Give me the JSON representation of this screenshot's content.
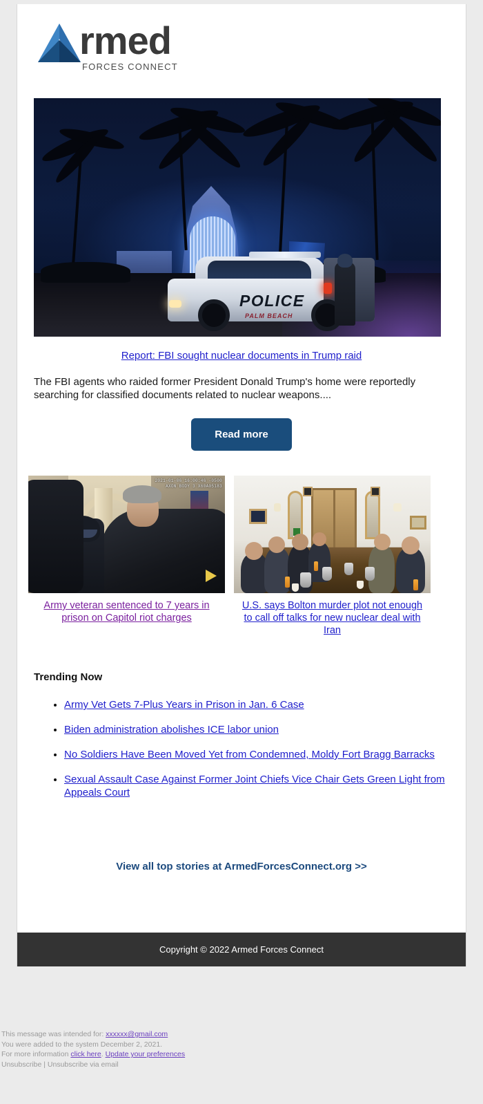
{
  "brand": {
    "logo_word": "rmed",
    "logo_sub": "FORCES CONNECT",
    "logo_icon": "triangle-logo-icon",
    "accent_blue": "#3a7cb8",
    "accent_navy": "#1a3a5c"
  },
  "hero": {
    "image_alt": "Police vehicle parked at night outside the blue-lit entrance of Mar-a-Lago with palm trees",
    "image_overlay_police": "POLICE",
    "image_overlay_dept": "PALM BEACH",
    "headline": "Report: FBI sought nuclear documents in Trump raid",
    "summary": "The FBI agents who raided former President Donald Trump's home were reportedly searching for classified documents related to nuclear weapons....",
    "button_label": "Read more",
    "button_color": "#1a4d7c"
  },
  "stories": [
    {
      "image_alt": "Bodycam footage of police officers confronting a man inside the U.S. Capitol",
      "timestamp_overlay_line1": "2021-01-06 16:00:46 -0500",
      "timestamp_overlay_line2": "AXON BODY 3 X60A05183",
      "title": "Army veteran sentenced to 7 years in prison on Capitol riot charges",
      "link_state": "visited"
    },
    {
      "image_alt": "Delegates seated around a long conference table during nuclear talks in an ornate meeting room",
      "timestamp_overlay_line1": "",
      "timestamp_overlay_line2": "",
      "title": "U.S. says Bolton murder plot not enough to call off talks for new nuclear deal with Iran",
      "link_state": "unvisited"
    }
  ],
  "trending": {
    "heading": "Trending Now",
    "items": [
      "Army Vet Gets 7-Plus Years in Prison in Jan. 6 Case",
      "Biden administration abolishes ICE labor union",
      "No Soldiers Have Been Moved Yet from Condemned, Moldy Fort Bragg Barracks",
      "Sexual Assault Case Against Former Joint Chiefs Vice Chair Gets Green Light from Appeals Court"
    ]
  },
  "cta": {
    "label": "View all top stories at ArmedForcesConnect.org >>"
  },
  "footer": {
    "copyright": "Copyright © 2022 Armed Forces Connect"
  },
  "disclaimer": {
    "intended_prefix": "This message was intended for:",
    "intended_email": "xxxxxx@gmail.com",
    "added_line": "You were added to the system December 2, 2021.",
    "more_info_prefix": "For more information",
    "click_here": "click here",
    "more_info_sep": ".",
    "update_prefs": "Update your preferences",
    "unsubscribe_line": "Unsubscribe | Unsubscribe via email"
  }
}
